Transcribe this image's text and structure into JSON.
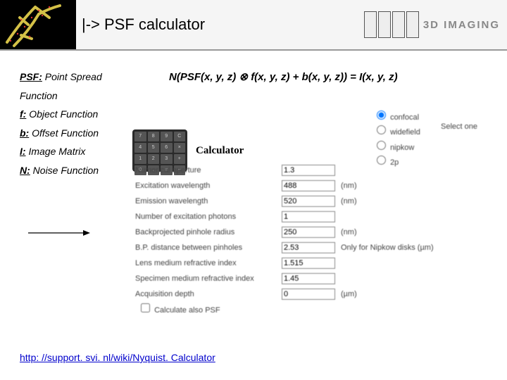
{
  "header": {
    "title": "|-> PSF calculator",
    "logo_text": "3D IMAGING"
  },
  "definitions": {
    "psf": {
      "term": "PSF:",
      "desc": " Point Spread Function"
    },
    "f": {
      "term": "f:",
      "desc": " Object Function"
    },
    "b": {
      "term": "b:",
      "desc": " Offset Function"
    },
    "i": {
      "term": "I:",
      "desc": " Image Matrix"
    },
    "n": {
      "term": "N:",
      "desc": " Noise Function"
    }
  },
  "formula": "N(PSF(x, y, z) ⊗ f(x, y, z) + b(x, y, z)) = I(x, y, z)",
  "calc": {
    "label": "Calculator",
    "keys": [
      "7",
      "8",
      "9",
      "C",
      "4",
      "5",
      "6",
      "×",
      "1",
      "2",
      "3",
      "+",
      "0",
      ".",
      "=",
      "−"
    ]
  },
  "radios": {
    "opt1": "confocal",
    "opt2": "widefield",
    "opt3": "nipkow",
    "opt4": "2p",
    "select_one": "Select one"
  },
  "form": {
    "rows": [
      {
        "label": "Numerical aperture",
        "value": "1.3",
        "unit": ""
      },
      {
        "label": "Excitation wavelength",
        "value": "488",
        "unit": "(nm)"
      },
      {
        "label": "Emission wavelength",
        "value": "520",
        "unit": "(nm)"
      },
      {
        "label": "Number of excitation photons",
        "value": "1",
        "unit": ""
      },
      {
        "label": "Backprojected pinhole radius",
        "value": "250",
        "unit": "(nm)"
      },
      {
        "label": "B.P. distance between pinholes",
        "value": "2.53",
        "unit": "Only for Nipkow disks (µm)"
      },
      {
        "label": "Lens medium refractive index",
        "value": "1.515",
        "unit": ""
      },
      {
        "label": "Specimen medium refractive index",
        "value": "1.45",
        "unit": ""
      },
      {
        "label": "Acquisition depth",
        "value": "0",
        "unit": "(µm)"
      }
    ],
    "checkbox_label": "Calculate also PSF"
  },
  "link": {
    "text": "http: //support. svi. nl/wiki/Nyquist. Calculator",
    "href": "http://support.svi.nl/wiki/NyquistCalculator"
  }
}
